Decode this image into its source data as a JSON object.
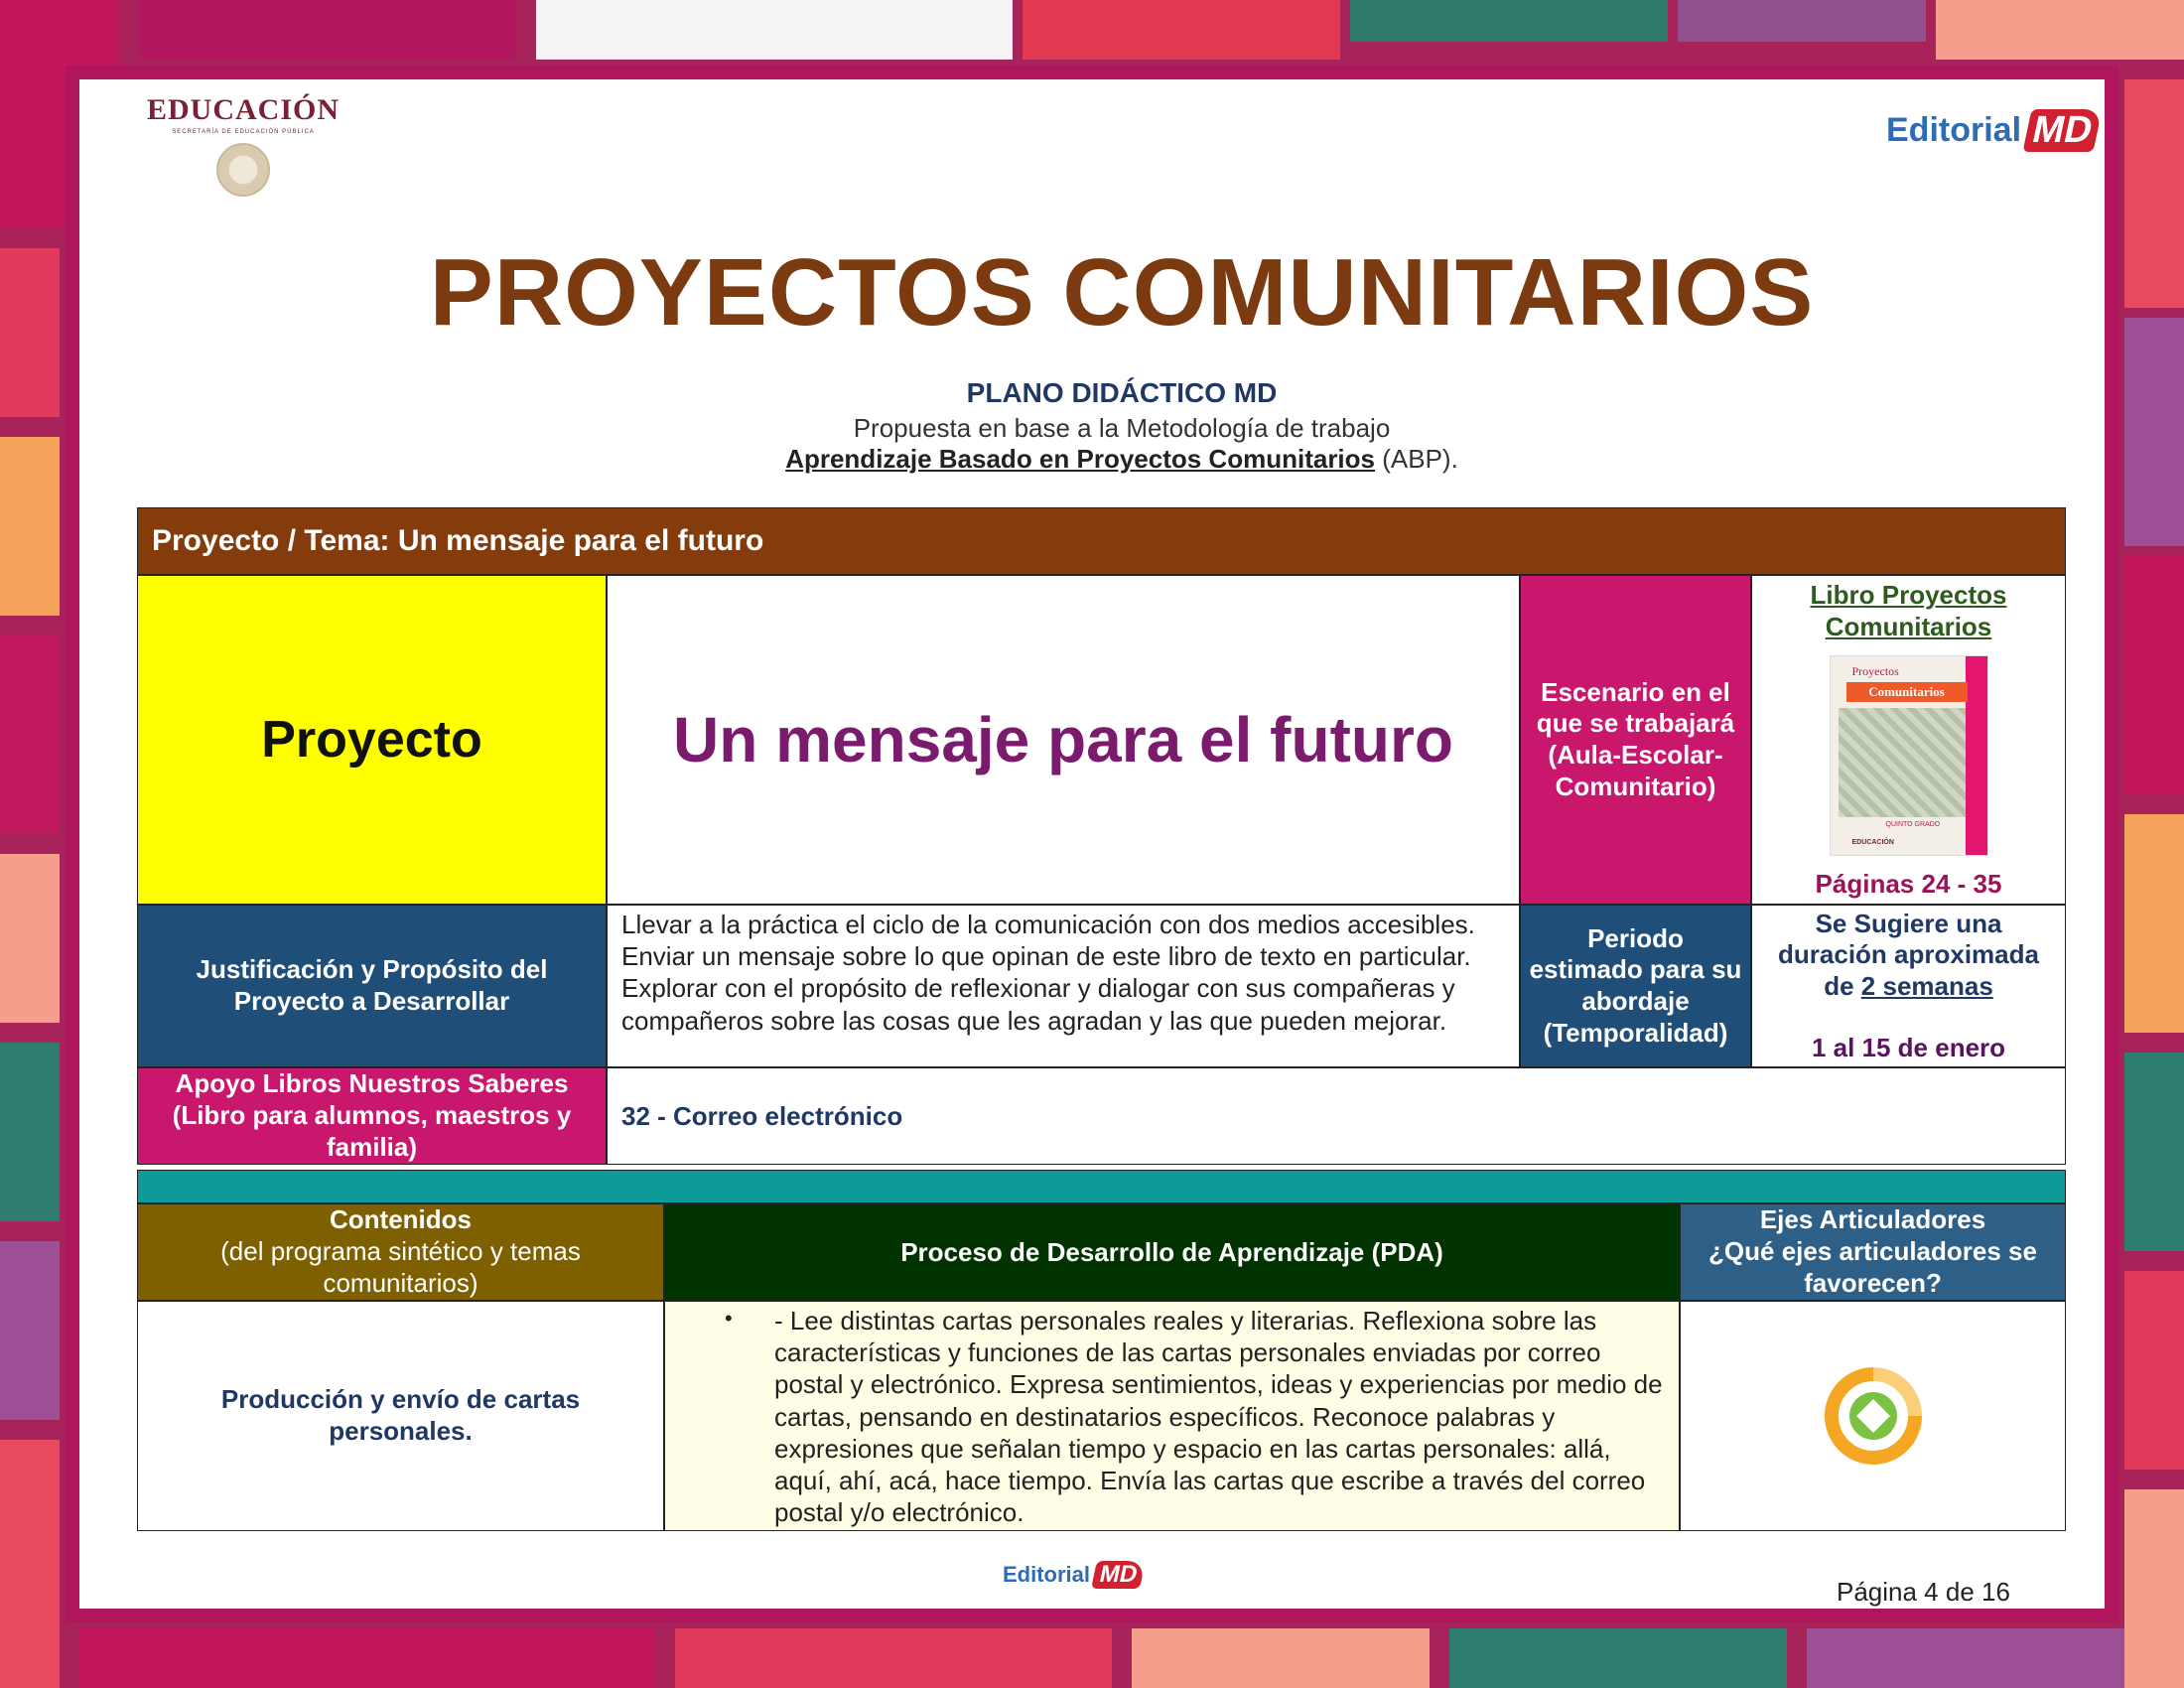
{
  "header": {
    "sep_logo_text": "EDUCACIÓN",
    "sep_logo_subtext": "SECRETARÍA DE EDUCACIÓN PÚBLICA",
    "editorial_word": "Editorial",
    "editorial_mark": "MD"
  },
  "title": "PROYECTOS COMUNITARIOS",
  "subtitle": {
    "plano": "PLANO DIDÁCTICO MD",
    "propuesta": "Propuesta en base a la Metodología de trabajo",
    "abp_bold": "Aprendizaje Basado en Proyectos Comunitarios",
    "abp_suffix": " (ABP)."
  },
  "table1": {
    "header": "Proyecto / Tema: Un mensaje para el futuro",
    "proyecto_label": "Proyecto",
    "proyecto_name": "Un mensaje para el futuro",
    "escenario_label": "Escenario en el que se trabajará (Aula-Escolar-Comunitario)",
    "libro_link": "Libro Proyectos Comunitarios",
    "book_cover": {
      "top": "Proyectos",
      "title": "Comunitarios",
      "grade": "QUINTO GRADO",
      "publisher": "EDUCACIÓN"
    },
    "paginas": "Páginas 24 - 35",
    "justificacion_label": "Justificación y Propósito del Proyecto a Desarrollar",
    "justificacion_text": "Llevar a la práctica el ciclo de la comunicación con dos medios accesibles. Enviar un mensaje sobre lo que opinan de este libro de texto en particular. Explorar con el propósito de reflexionar y dialogar con sus compañeras y compañeros sobre las cosas que les agradan y las que pueden mejorar.",
    "periodo_label": "Periodo estimado para su abordaje (Temporalidad)",
    "duracion_prefix": "Se Sugiere una duración aproximada de ",
    "duracion_underlined": "2 semanas",
    "fechas": "1 al 15 de enero",
    "apoyo_label": "Apoyo Libros Nuestros Saberes (Libro para alumnos, maestros y familia)",
    "apoyo_value": "32 - Correo electrónico"
  },
  "table2": {
    "contenidos_title": "Contenidos",
    "contenidos_sub": "(del programa sintético y temas comunitarios)",
    "pda_header": "Proceso de Desarrollo de Aprendizaje (PDA)",
    "ejes_title": "Ejes Articuladores",
    "ejes_sub": "¿Qué ejes articuladores se favorecen?",
    "contenido": "Producción y envío de cartas personales.",
    "bullet": "•",
    "pda_text": "- Lee distintas cartas personales reales y literarias. Reflexiona sobre las características y funciones de las cartas personales enviadas por correo postal y electrónico. Expresa sentimientos, ideas y experiencias por medio de cartas, pensando en destinatarios específicos. Reconoce palabras y expresiones que señalan tiempo y espacio en las cartas personales: allá, aquí, ahí, acá, hace tiempo. Envía las cartas que escribe a través del correo postal y/o electrónico.",
    "eje_icon": "eje-articulador-icon"
  },
  "footer": {
    "editorial_word": "Editorial",
    "editorial_mark": "MD",
    "page_number": "Página 4 de 16"
  },
  "colors": {
    "title_brown": "#7b3a10",
    "header_brown": "#843c0c",
    "yellow": "#ffff00",
    "magenta": "#c9176d",
    "navy": "#1f4e79",
    "teal": "#0f9a9a",
    "olive": "#7f6000",
    "dark_green": "#003300",
    "steel_blue": "#2e5f87",
    "pale_yellow": "#fffde5"
  }
}
